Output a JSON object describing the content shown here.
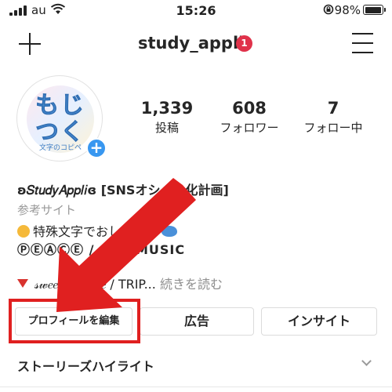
{
  "status_bar": {
    "carrier": "au",
    "time": "15:26",
    "battery": "98%",
    "battery_level": 0.98
  },
  "header": {
    "username": "study_appli",
    "notification_count": "1",
    "icons": [
      "plus-icon",
      "menu-icon"
    ]
  },
  "profile": {
    "avatar_text_line1": "もじ",
    "avatar_text_line2": "つく",
    "avatar_subtext": "文字のコピペ",
    "stats": [
      {
        "value": "1,339",
        "label": "投稿"
      },
      {
        "value": "608",
        "label": "フォロワー"
      },
      {
        "value": "7",
        "label": "フォロー中"
      }
    ]
  },
  "bio": {
    "title": "ʚ𝑆𝑡𝑢𝑑𝑦𝐴𝑝𝑝𝑙𝑖ɞ [SNSオシャレ化計画]",
    "category": "参考サイト",
    "line3": "特殊文字でおしゃれる",
    "line4": "ⓅⒺⒶⒸⒺ / SNS MUSIC",
    "line5_text": "𝓈𝓌𝑒𝑒𝓉 𝓅𝒾𝒸𝓉𝓊𝓇𝑒 / TRIP...",
    "line5_more": " 続きを読む"
  },
  "buttons": {
    "edit_profile": "プロフィールを編集",
    "ads": "広告",
    "insights": "インサイト"
  },
  "stories": {
    "label": "ストーリーズハイライト"
  },
  "colors": {
    "accent_red": "#e02020",
    "badge_red": "#e0324a",
    "link_blue": "#3897f0"
  }
}
